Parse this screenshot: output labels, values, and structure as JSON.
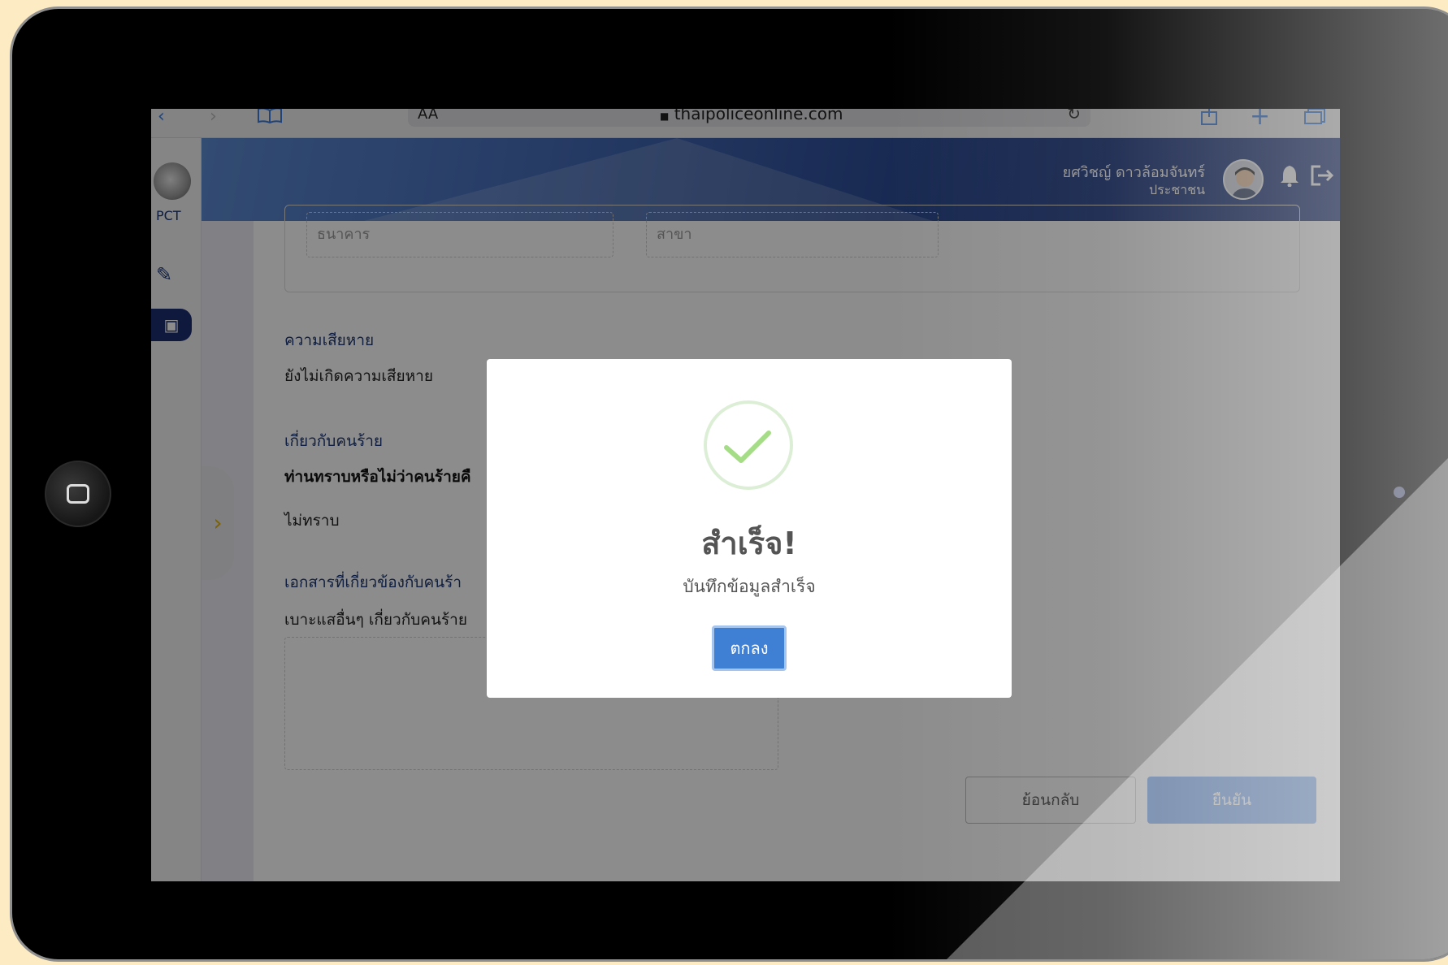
{
  "browser": {
    "url": "thaipoliceonline.com",
    "reader_label": "AA",
    "icons": [
      "back-icon",
      "forward-icon",
      "bookmarks-icon",
      "reload-icon",
      "share-icon",
      "new-tab-icon",
      "tabs-icon"
    ]
  },
  "header": {
    "user_name": "ยศวิชญ์ ดาวล้อมจันทร์",
    "user_role": "ประชาชน",
    "icons": [
      "avatar",
      "bell-icon",
      "logout-icon"
    ]
  },
  "sidebar": {
    "logo_text": "PCT",
    "icons": [
      "edit-icon",
      "folder-add-icon",
      "chevron-right-icon"
    ]
  },
  "form": {
    "bank_placeholder": "ธนาคาร",
    "branch_placeholder": "สาขา",
    "damage_title": "ความเสียหาย",
    "damage_value": "ยังไม่เกิดความเสียหาย",
    "suspect_title": "เกี่ยวกับคนร้าย",
    "suspect_question": "ท่านทราบหรือไม่ว่าคนร้ายคื",
    "suspect_answer": "ไม่ทราบ",
    "docs_title": "เอกสารที่เกี่ยวข้องกับคนร้า",
    "docs_label": "เบาะแสอื่นๆ เกี่ยวกับคนร้าย",
    "back_button": "ย้อนกลับ",
    "confirm_button": "ยืนยัน"
  },
  "modal": {
    "title": "สำเร็จ!",
    "message": "บันทึกข้อมูลสำเร็จ",
    "ok_button": "ตกลง",
    "icon": "success-check-icon"
  },
  "colors": {
    "accent_blue": "#3f7fd4",
    "header_dark": "#1b3177",
    "success_green": "#a5dc86",
    "sidebar_gold": "#e2b400"
  }
}
